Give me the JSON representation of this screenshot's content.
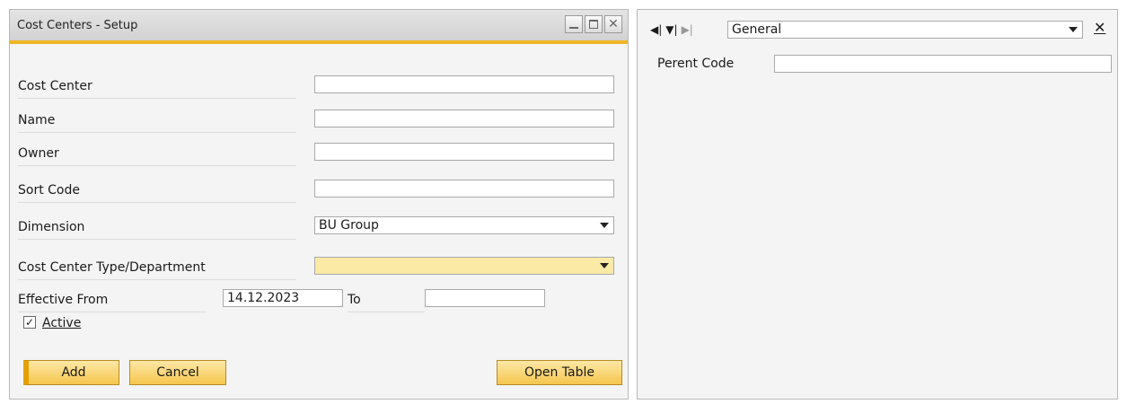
{
  "window": {
    "title": "Cost Centers - Setup"
  },
  "form": {
    "cost_center": {
      "label": "Cost Center",
      "value": ""
    },
    "name": {
      "label": "Name",
      "value": ""
    },
    "owner": {
      "label": "Owner",
      "value": ""
    },
    "sort_code": {
      "label": "Sort Code",
      "value": ""
    },
    "dimension": {
      "label": "Dimension",
      "value": "BU Group"
    },
    "type": {
      "label": "Cost Center Type/Department",
      "value": ""
    },
    "effective_from": {
      "label": "Effective From",
      "value": "14.12.2023"
    },
    "to": {
      "label": "To",
      "value": ""
    },
    "active": {
      "label": "Active",
      "checked": true,
      "check_glyph": "✓"
    }
  },
  "buttons": {
    "add": "Add",
    "cancel": "Cancel",
    "open_table": "Open Table"
  },
  "udf_panel": {
    "selector": "General",
    "parent_code": {
      "label": "Perent Code",
      "value": ""
    }
  },
  "colors": {
    "accent": "#f0b625",
    "mandatory_field": "#fbe9a6"
  }
}
